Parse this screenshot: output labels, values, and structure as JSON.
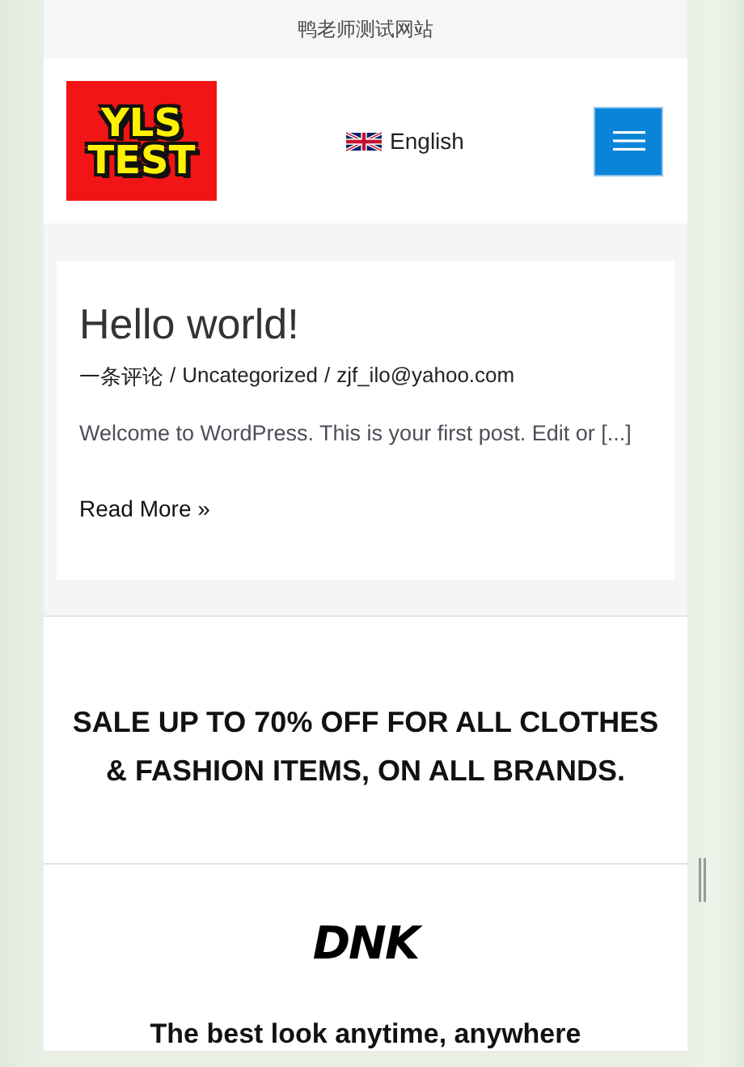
{
  "top_bar": {
    "title": "鸭老师测试网站"
  },
  "header": {
    "logo": {
      "line_1": "YLS",
      "line_2": "TEST"
    },
    "language": "English"
  },
  "posts": [
    {
      "title": "Hello world!",
      "meta": [
        "一条评论",
        "Uncategorized",
        "zjf_ilo@yahoo.com"
      ],
      "meta_separator": "/",
      "excerpt": "Welcome to WordPress. This is your first post. Edit or [...]",
      "read_more": "Read More »"
    }
  ],
  "promo": {
    "headline": "SALE UP TO 70% OFF FOR ALL CLOTHES & FASHION ITEMS, ON ALL BRANDS."
  },
  "brand": {
    "logo": "DNK",
    "tagline": "The best look anytime, anywhere"
  }
}
